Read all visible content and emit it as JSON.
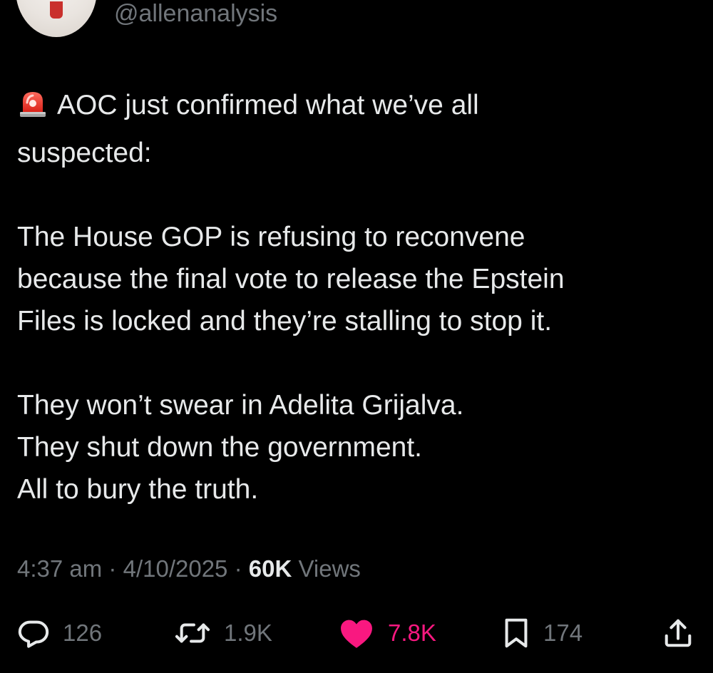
{
  "author": {
    "handle": "@allenanalysis"
  },
  "tweet": {
    "emoji_icon": "police-siren-icon",
    "first_line": "AOC just confirmed what we’ve all\nsuspected:",
    "paragraph_2": "The House GOP is refusing to reconvene\nbecause the final vote to release the Epstein\nFiles is locked and they’re stalling to stop it.",
    "paragraph_3": "They won’t swear in Adelita Grijalva.\nThey shut down the government.\nAll to bury the truth."
  },
  "meta": {
    "time": "4:37 am",
    "separator": "·",
    "date": "4/10/2025",
    "views_count": "60K",
    "views_label": "Views"
  },
  "actions": {
    "replies": "126",
    "reposts": "1.9K",
    "likes": "7.8K",
    "bookmarks": "174"
  },
  "colors": {
    "background": "#000000",
    "text": "#e7e9ea",
    "secondary": "#71767b",
    "like_active": "#f91880"
  }
}
